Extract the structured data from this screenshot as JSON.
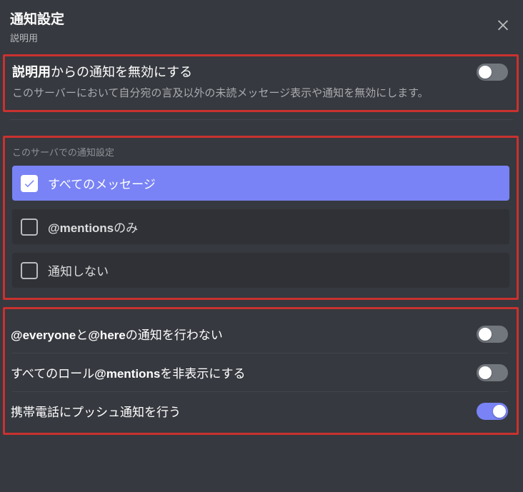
{
  "header": {
    "title": "通知設定",
    "subtitle": "説明用",
    "close_icon": "close"
  },
  "mute": {
    "label_bold": "説明用",
    "label_rest": "からの通知を無効にする",
    "description": "このサーバーにおいて自分宛の言及以外の未読メッセージ表示や通知を無効にします。",
    "enabled": false
  },
  "radio_group": {
    "heading": "このサーバでの通知設定",
    "options": [
      {
        "label": "すべてのメッセージ",
        "selected": true
      },
      {
        "label_prefix": "@mentions",
        "label_suffix": "のみ",
        "selected": false
      },
      {
        "label": "通知しない",
        "selected": false
      }
    ]
  },
  "toggles": [
    {
      "label_parts": [
        "@everyone",
        "と",
        "@here",
        "の通知を行わない"
      ],
      "on": false
    },
    {
      "label_parts": [
        "すべてのロール",
        "@mentions",
        "を非表示にする"
      ],
      "on": false
    },
    {
      "label_parts": [
        "携帯電話にプッシュ通知を行う"
      ],
      "on": true
    }
  ],
  "colors": {
    "highlight_border": "#c9322f",
    "accent": "#7983f5"
  }
}
